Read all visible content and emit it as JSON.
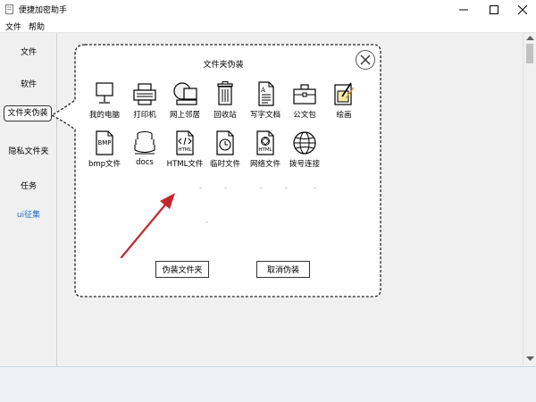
{
  "window": {
    "title": "便捷加密助手"
  },
  "menu": [
    "文件",
    "帮助"
  ],
  "sidebar": {
    "items": [
      {
        "label": "文件"
      },
      {
        "label": "软件"
      },
      {
        "label": "文件夹伪装"
      },
      {
        "label": "隐私文件夹"
      },
      {
        "label": "任务"
      },
      {
        "label": "ui征集"
      }
    ],
    "selected": "文件夹伪装"
  },
  "panel": {
    "title": "文件夹伪装",
    "icons": [
      {
        "label": "我的电脑",
        "icon": "computer-icon"
      },
      {
        "label": "打印机",
        "icon": "printer-icon"
      },
      {
        "label": "网上邻居",
        "icon": "network-neighborhood-icon"
      },
      {
        "label": "回收站",
        "icon": "recycle-bin-icon"
      },
      {
        "label": "写字文档",
        "icon": "text-document-icon"
      },
      {
        "label": "公文包",
        "icon": "briefcase-icon"
      },
      {
        "label": "绘画",
        "icon": "paint-icon"
      },
      {
        "label": "bmp文件",
        "icon": "bmp-file-icon",
        "badge": "BMP"
      },
      {
        "label": "docs",
        "icon": "docs-stack-icon"
      },
      {
        "label": "HTML文件",
        "icon": "html-file-icon",
        "badge": "HTML"
      },
      {
        "label": "临时文件",
        "icon": "temp-file-icon"
      },
      {
        "label": "网络文件",
        "icon": "network-file-icon",
        "badge": "HTML"
      },
      {
        "label": "拨号连接",
        "icon": "dialup-globe-icon"
      }
    ],
    "disguise_button": "伪装文件夹",
    "cancel_button": "取消伪装"
  },
  "colors": {
    "accent": "#1f6fc9",
    "arrow": "#c0282e",
    "selected_border": "#333333"
  }
}
